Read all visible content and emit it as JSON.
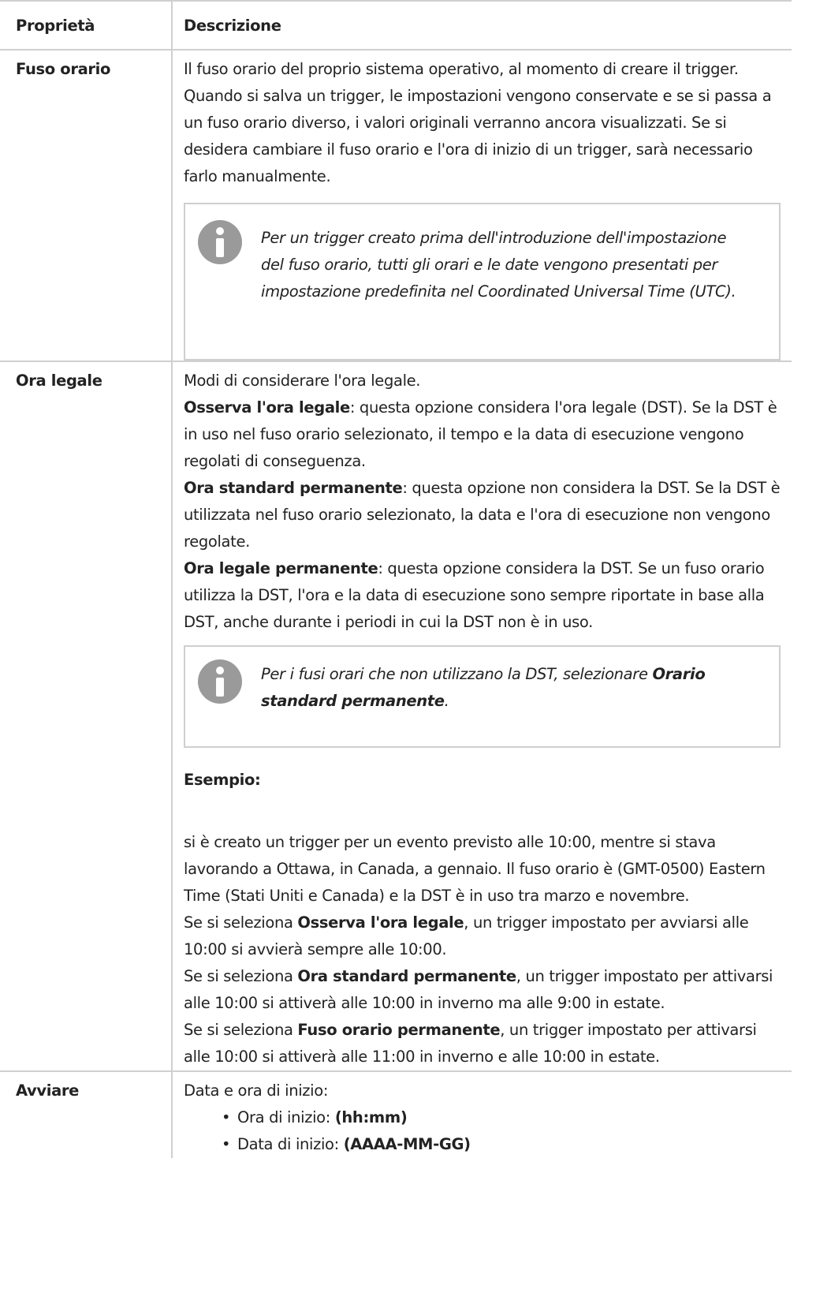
{
  "header": {
    "col1": "Proprietà",
    "col2": "Descrizione"
  },
  "fuso": {
    "name": "Fuso orario",
    "text": "Il fuso orario del proprio sistema operativo, al momento di creare il trigger. Quando si salva un trigger, le impostazioni vengono conservate e se si passa a un fuso orario diverso, i valori originali verranno ancora visualizzati. Se si desidera cambiare il fuso orario e l'ora di inizio di un trigger, sarà necessario farlo manualmente.",
    "note_icon": "info-icon",
    "note": "Per un trigger creato prima dell'introduzione dell'impostazione del fuso orario, tutti gli orari e le date vengono presentati per impostazione predefinita nel Coordinated Universal Time (UTC)."
  },
  "ora": {
    "name": "Ora legale",
    "intro": "Modi di considerare l'ora legale.",
    "opt1_label": "Osserva l'ora legale",
    "opt1_text": ": questa opzione considera l'ora legale (DST). Se la DST è in uso nel fuso orario selezionato, il tempo e la data di esecuzione vengono regolati di conseguenza.",
    "opt2_label": "Ora standard permanente",
    "opt2_text": ": questa opzione non considera la DST. Se la DST è utilizzata nel fuso orario selezionato, la data e l'ora di esecuzione non vengono regolate.",
    "opt3_label": "Ora legale permanente",
    "opt3_text": ": questa opzione considera la DST. Se un fuso orario utilizza la DST, l'ora e la data di esecuzione sono sempre riportate in base alla DST, anche durante i periodi in cui la DST non è in uso.",
    "note_icon": "info-icon",
    "note_pre": "Per i fusi orari che non utilizzano la DST, selezionare ",
    "note_bold": "Orario standard permanente",
    "note_post": ".",
    "example_heading": "Esempio:",
    "example_intro": "si è creato un trigger per un evento previsto alle 10:00, mentre si stava lavorando a Ottawa, in Canada, a gennaio. Il fuso orario è (GMT-0500) Eastern Time (Stati Uniti e Canada) e la DST è in uso tra marzo e novembre.",
    "ex1_pre": "Se si seleziona ",
    "ex1_bold": "Osserva l'ora legale",
    "ex1_post": ", un trigger impostato per avviarsi alle 10:00 si avvierà sempre alle 10:00.",
    "ex2_pre": "Se si seleziona ",
    "ex2_bold": "Ora standard permanente",
    "ex2_post": ", un trigger impostato per attivarsi alle 10:00 si attiverà alle 10:00 in inverno ma alle 9:00 in estate.",
    "ex3_pre": "Se si seleziona ",
    "ex3_bold": "Fuso orario permanente",
    "ex3_post": ", un trigger impostato per attivarsi alle 10:00 si attiverà alle 11:00 in inverno e alle 10:00 in estate."
  },
  "avviare": {
    "name": "Avviare",
    "intro": "Data e ora di inizio:",
    "item1_label": "Ora di inizio: ",
    "item1_value": "(hh:mm)",
    "item2_label": "Data di inizio: ",
    "item2_value": "(AAAA-MM-GG)"
  }
}
